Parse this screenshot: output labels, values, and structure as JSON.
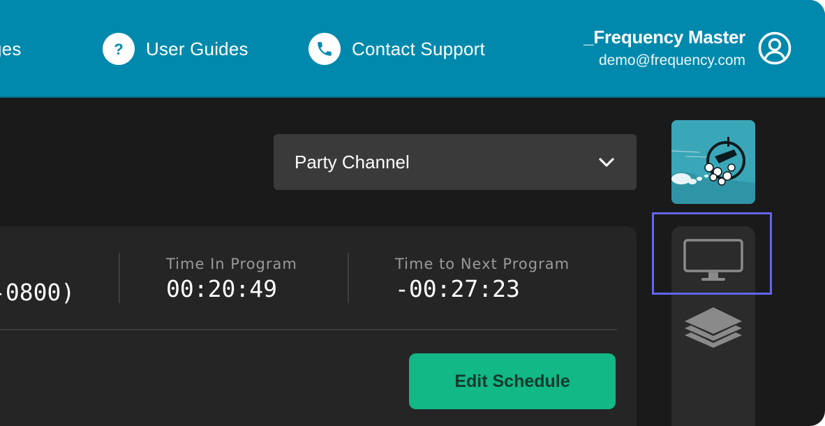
{
  "header": {
    "nav": {
      "messages_label": "ges",
      "guides_label": "User Guides",
      "support_label": "Contact Support"
    },
    "user": {
      "name": "_Frequency Master",
      "email": "demo@frequency.com"
    },
    "icons": {
      "guides": "help-circle-icon",
      "support": "phone-icon",
      "user": "user-avatar-icon"
    }
  },
  "channel": {
    "selected": "Party Channel",
    "icon": "chevron-down-icon"
  },
  "status": {
    "timezone_value": "-0800)",
    "time_in_program": {
      "label": "Time In Program",
      "value": "00:20:49"
    },
    "time_to_next": {
      "label": "Time to Next Program",
      "value": "-00:27:23"
    },
    "edit_schedule_label": "Edit Schedule"
  },
  "rail": {
    "items": [
      {
        "icon": "monitor-icon",
        "selected": true
      },
      {
        "icon": "layers-icon",
        "selected": false
      }
    ]
  },
  "colors": {
    "header_bg": "#0089ad",
    "app_bg": "#1a1a1a",
    "accent_green": "#12b886",
    "highlight": "#6366f1"
  }
}
